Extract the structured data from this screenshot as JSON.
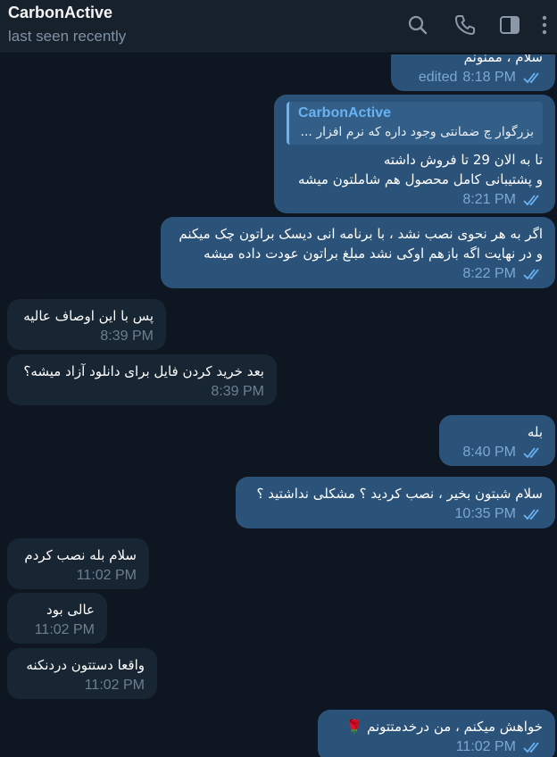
{
  "header": {
    "name": "CarbonActive",
    "status": "last seen recently"
  },
  "icons": {
    "search": "search-icon",
    "call": "phone-icon",
    "sidebar": "sidebar-toggle-icon",
    "more": "more-vertical-icon",
    "read": "double-check-icon"
  },
  "colors": {
    "background": "#0e1621",
    "header": "#17212b",
    "outgoing_bubble": "#2b5278",
    "incoming_bubble": "#182533",
    "accent": "#6ab3f3"
  },
  "messages": [
    {
      "dir": "out",
      "lines": [
        "سلام ، ممنونم"
      ],
      "edited": "edited",
      "time": "8:18 PM"
    },
    {
      "dir": "out",
      "reply": {
        "name": "CarbonActive",
        "text": "بزرگوار چ ضمانتی وجود داره که نرم افزار ..."
      },
      "lines": [
        "تا به الان 29 تا فروش داشته",
        "و پشتیبانی کامل محصول هم شاملتون میشه"
      ],
      "time": "8:21 PM"
    },
    {
      "dir": "out",
      "lines": [
        "اگر به هر نحوی نصب نشد ، با برنامه انی دیسک براتون چک میکنم",
        "و در نهایت اگه بازهم اوکی نشد مبلغ براتون عودت داده میشه"
      ],
      "time": "8:22 PM"
    },
    {
      "dir": "in",
      "lines": [
        "پس با این اوصاف عالیه"
      ],
      "time": "8:39 PM"
    },
    {
      "dir": "in",
      "lines": [
        "بعد خرید کردن فایل برای دانلود آزاد میشه؟"
      ],
      "time": "8:39 PM"
    },
    {
      "dir": "out",
      "lines": [
        "بله"
      ],
      "time": "8:40 PM"
    },
    {
      "dir": "out",
      "lines": [
        "سلام شبتون بخیر ، نصب کردید ؟ مشکلی نداشتید ؟"
      ],
      "time": "10:35 PM"
    },
    {
      "dir": "in",
      "lines": [
        "سلام بله نصب کردم"
      ],
      "time": "11:02 PM"
    },
    {
      "dir": "in",
      "lines": [
        "عالی بود"
      ],
      "time": "11:02 PM"
    },
    {
      "dir": "in",
      "lines": [
        "واقعا دستتون دردنکنه"
      ],
      "time": "11:02 PM"
    },
    {
      "dir": "out",
      "lines": [
        "خواهش میکنم ، من درخدمتتونم"
      ],
      "emoji": "🌹",
      "time": "11:02 PM"
    }
  ]
}
